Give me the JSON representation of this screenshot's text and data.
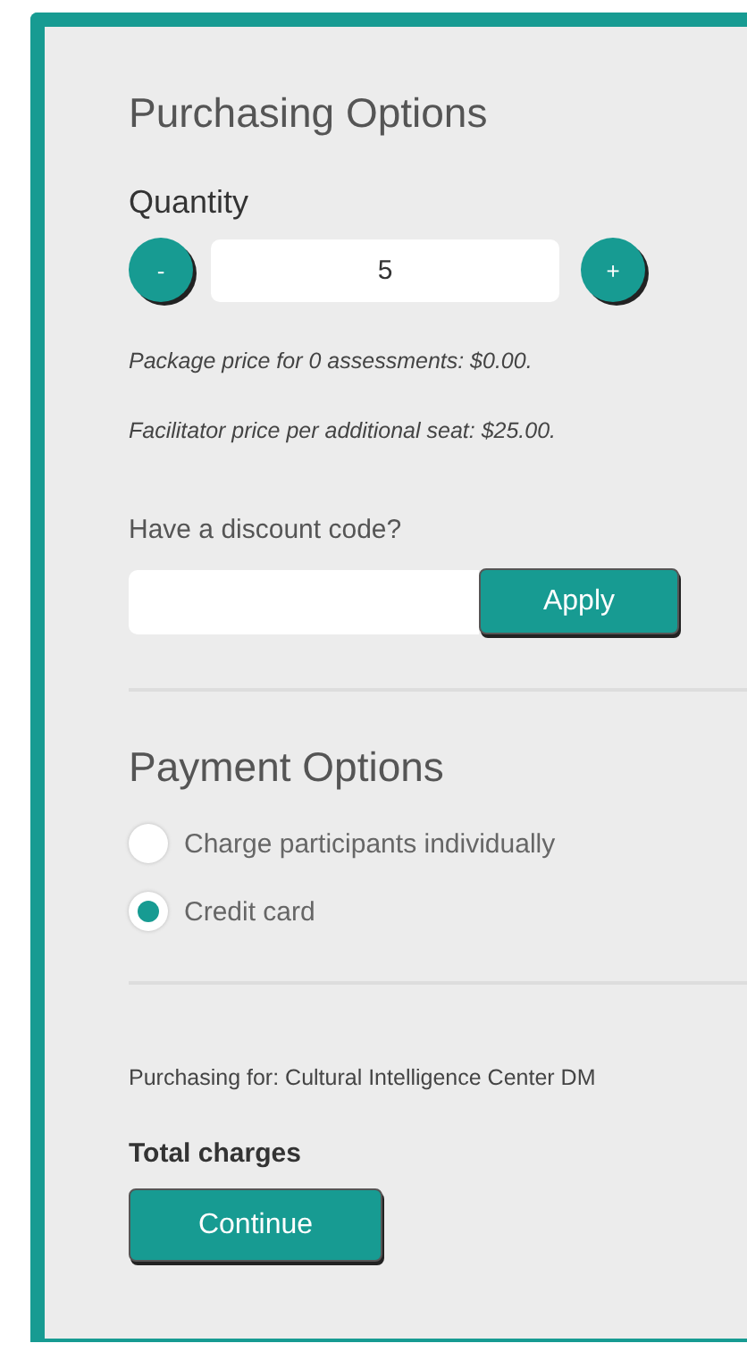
{
  "purchasing": {
    "title": "Purchasing Options",
    "quantity_label": "Quantity",
    "decrement": "-",
    "quantity": "5",
    "increment": "+",
    "notes": [
      "Package price for 0 assessments: $0.00.",
      "Facilitator price per additional seat: $25.00."
    ],
    "discount_label": "Have a discount code?",
    "apply": "Apply"
  },
  "payment": {
    "title": "Payment Options",
    "options": [
      {
        "label": "Charge participants individually",
        "selected": false
      },
      {
        "label": "Credit card",
        "selected": true
      }
    ]
  },
  "purchasing_for": "Purchasing for: Cultural Intelligence Center DM",
  "total_label": "Total charges",
  "continue": "Continue"
}
